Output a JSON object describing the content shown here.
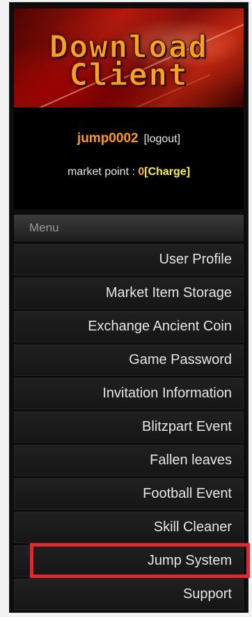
{
  "banner": {
    "line1": "Download",
    "line2": "Client"
  },
  "user": {
    "name": "jump0002",
    "logout_label": "[logout]",
    "market_point_label": "market point : ",
    "market_point_value": "0",
    "charge_label": "[Charge]"
  },
  "menu": {
    "header": "Menu",
    "items": [
      {
        "label": "User Profile"
      },
      {
        "label": "Market Item Storage"
      },
      {
        "label": "Exchange Ancient Coin"
      },
      {
        "label": "Game Password"
      },
      {
        "label": "Invitation Information"
      },
      {
        "label": "Blitzpart Event"
      },
      {
        "label": "Fallen leaves"
      },
      {
        "label": "Football Event"
      },
      {
        "label": "Skill Cleaner"
      },
      {
        "label": "Jump System",
        "highlighted": true
      },
      {
        "label": "Support"
      }
    ]
  },
  "colors": {
    "highlight_box": "#e8242d",
    "username": "#ff9a0e",
    "charge": "#fff230",
    "banner_text": "#ffa01c"
  }
}
